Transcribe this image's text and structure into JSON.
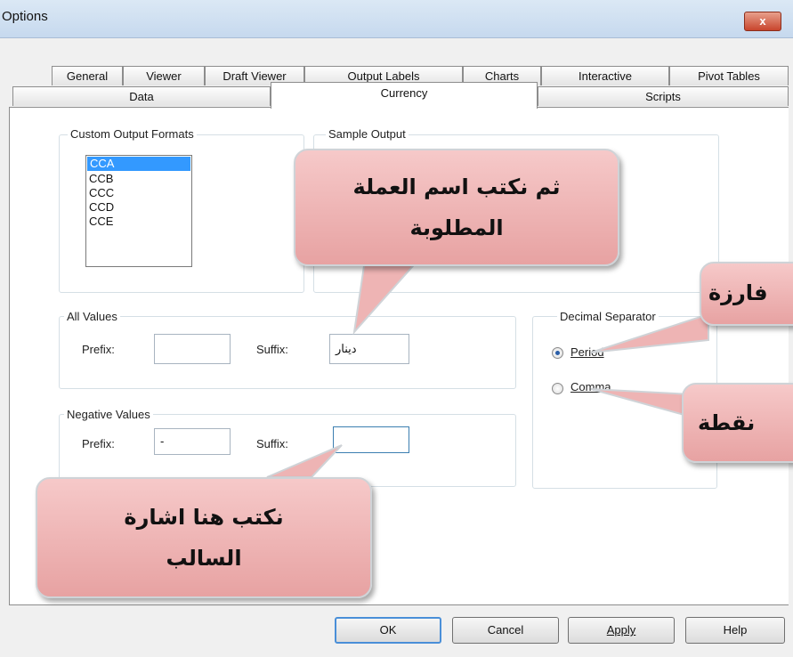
{
  "window": {
    "title": "Options",
    "close_glyph": "x"
  },
  "tabs": {
    "row1": [
      "General",
      "Viewer",
      "Draft Viewer",
      "Output Labels",
      "Charts",
      "Interactive",
      "Pivot Tables"
    ],
    "row2": [
      "Data",
      "Currency",
      "Scripts"
    ],
    "active": "Currency"
  },
  "custom_output_formats": {
    "legend": "Custom Output Formats",
    "items": [
      "CCA",
      "CCB",
      "CCC",
      "CCD",
      "CCE"
    ],
    "selected": "CCA"
  },
  "sample_output": {
    "legend": "Sample Output"
  },
  "all_values": {
    "legend": "All Values",
    "prefix_label": "Prefix:",
    "prefix_value": "",
    "suffix_label": "Suffix:",
    "suffix_value": "دينار"
  },
  "negative_values": {
    "legend": "Negative Values",
    "prefix_label": "Prefix:",
    "prefix_value": "-",
    "suffix_label": "Suffix:",
    "suffix_value": ""
  },
  "decimal_separator": {
    "legend": "Decimal Separator",
    "options": [
      "Period",
      "Comma"
    ],
    "selected": "Period"
  },
  "buttons": {
    "ok": "OK",
    "cancel": "Cancel",
    "apply": "Apply",
    "help": "Help"
  },
  "callouts": {
    "currency_name": [
      "ثم نكتب اسم العملة",
      "المطلوبة"
    ],
    "comma": "فارزة",
    "period": "نقطة",
    "negative_sign": [
      "نكتب هنا اشارة",
      "السالب"
    ]
  },
  "colors": {
    "callout_fill": "#eeb4b4",
    "selection": "#3399ff",
    "radio_dot": "#2a5ea8"
  }
}
